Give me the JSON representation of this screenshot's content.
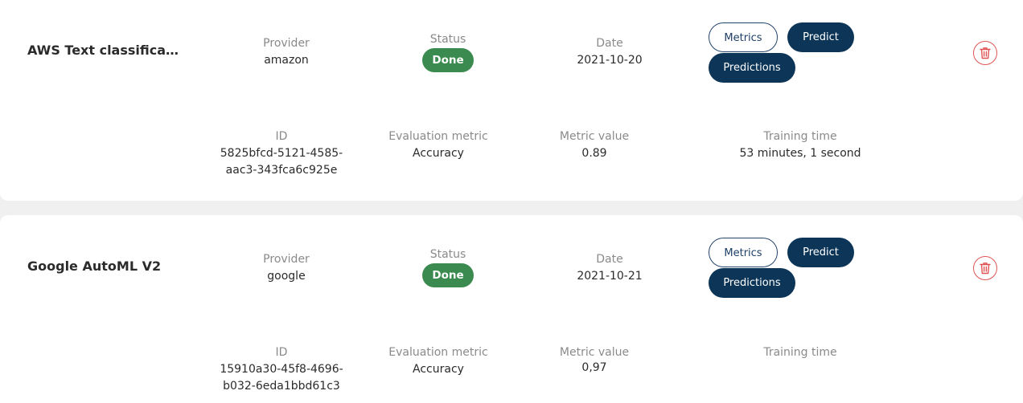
{
  "labels": {
    "provider": "Provider",
    "status": "Status",
    "date": "Date",
    "id": "ID",
    "evaluation_metric": "Evaluation metric",
    "metric_value": "Metric value",
    "training_time": "Training time"
  },
  "buttons": {
    "metrics": "Metrics",
    "predict": "Predict",
    "predictions": "Predictions"
  },
  "colors": {
    "status_done": "#3b8a4f",
    "primary": "#0c3558",
    "delete": "#e05353"
  },
  "models": [
    {
      "name": "AWS Text classificatio...",
      "provider": "amazon",
      "status": "Done",
      "date": "2021-10-20",
      "id_line1": "5825bfcd-5121-4585-",
      "id_line2": "aac3-343fca6c925e",
      "evaluation_metric": "Accuracy",
      "metric_value": "0.89",
      "training_time": "53 minutes, 1 second",
      "delete_icon": "trash-icon"
    },
    {
      "name": "Google AutoML V2",
      "provider": "google",
      "status": "Done",
      "date": "2021-10-21",
      "id_line1": "15910a30-45f8-4696-",
      "id_line2": "b032-6eda1bbd61c3",
      "evaluation_metric": "Accuracy",
      "metric_value": "0,97",
      "training_time": "",
      "delete_icon": "trash-icon"
    }
  ]
}
